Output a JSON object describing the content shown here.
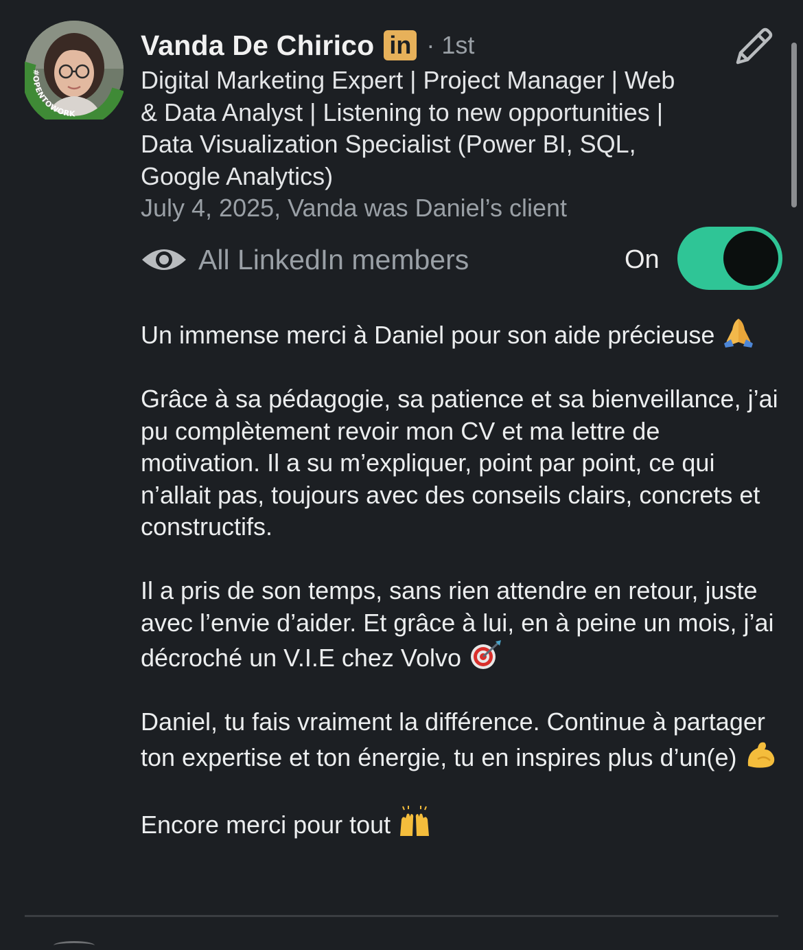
{
  "recommendation": {
    "author": {
      "name": "Vanda De Chirico",
      "badge": "in",
      "degree": "· 1st",
      "open_to_work_ring_text": "#OPENTOWORK",
      "headline": "Digital Marketing Expert | Project Manager | Web & Data Analyst | Listening to new opportunities | Data Visualization Specialist (Power BI, SQL, Google Analytics)"
    },
    "date_relation": "July 4, 2025, Vanda was Daniel’s client",
    "visibility": {
      "icon": "eye-icon",
      "label": "All LinkedIn members",
      "toggle_label": "On",
      "toggle_on": true
    },
    "paragraphs": [
      {
        "text": "Un immense merci à Daniel pour son aide précieuse ",
        "emoji": "folded-hands"
      },
      {
        "text": "Grâce à sa pédagogie, sa patience et sa bienveillance, j’ai pu complètement revoir mon CV et ma lettre de motivation. Il a su m’expliquer, point par point, ce qui n’allait pas, toujours avec des conseils clairs, concrets et constructifs."
      },
      {
        "text": "Il a pris de son temps, sans rien attendre en retour, juste avec l’envie d’aider. Et grâce à lui, en à peine un mois, j’ai décroché un V.I.E chez Volvo ",
        "emoji": "direct-hit"
      },
      {
        "text": "Daniel, tu fais vraiment la différence. Continue à partager ton expertise et ton énergie, tu en inspires plus d’un(e) ",
        "emoji": "flexed-biceps"
      },
      {
        "text": "Encore merci pour tout ",
        "emoji": "raising-hands"
      }
    ]
  },
  "colors": {
    "background": "#1c1f23",
    "toggle_on": "#2fc596",
    "linkedin_badge": "#e7b15a",
    "open_to_work_green": "#3f8a36"
  }
}
